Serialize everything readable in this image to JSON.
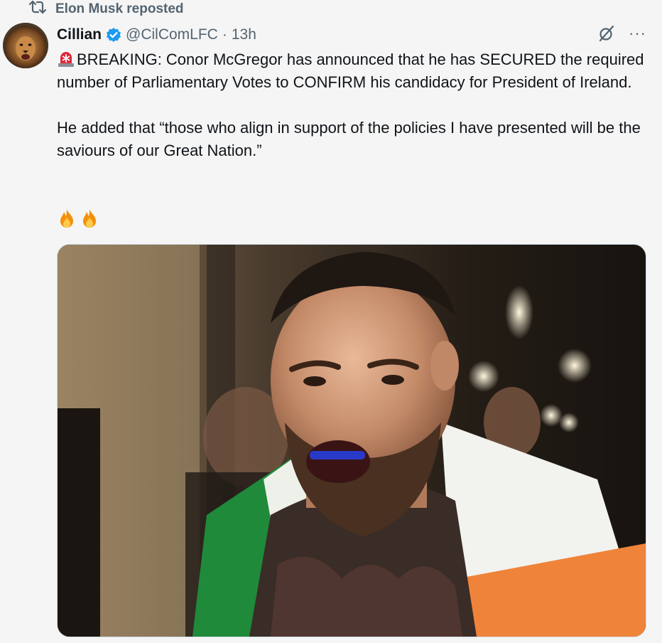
{
  "repost": {
    "label": "Elon Musk reposted",
    "icon": "repost-icon"
  },
  "author": {
    "display_name": "Cillian",
    "handle": "@CilComLFC",
    "separator": "·",
    "time": "13h",
    "verified_icon": "verified-badge-icon",
    "verified_color": "#1d9bf0",
    "avatar_icon": "lion-avatar"
  },
  "actions": {
    "grok_icon": "grok-icon",
    "more_label": "···"
  },
  "tweet": {
    "para1": "BREAKING: Conor McGregor has announced that he has SECURED the required number of Parliamentary Votes to CONFIRM his candidacy for President of Ireland.",
    "para2": "He added that “those who align in support of the policies I have presented will be the saviours of our Great Nation.”",
    "emoji_icons": [
      "siren-icon",
      "fire-icon",
      "fire-icon"
    ]
  },
  "media": {
    "icon": "photo"
  },
  "colors": {
    "text": "#0f1419",
    "secondary": "#536471",
    "background": "#f5f5f5"
  }
}
